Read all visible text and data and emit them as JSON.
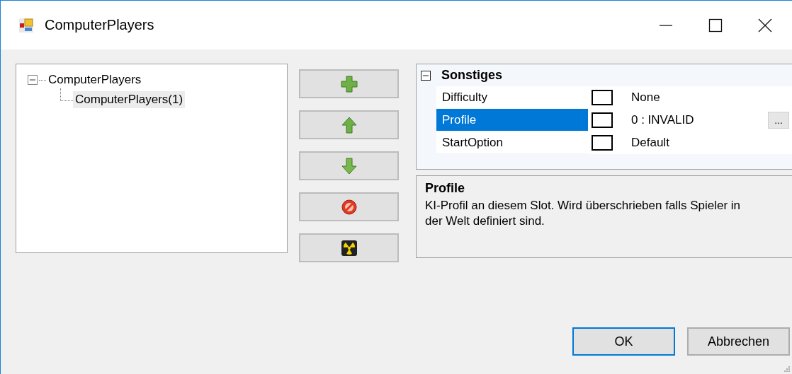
{
  "window": {
    "title": "ComputerPlayers"
  },
  "tree": [
    {
      "label": "ComputerPlayers",
      "expanded": true,
      "selected": false,
      "children": [
        {
          "label": "ComputerPlayers(1)",
          "selected": true
        }
      ]
    }
  ],
  "tool_buttons": [
    {
      "kind": "add"
    },
    {
      "kind": "up"
    },
    {
      "kind": "down"
    },
    {
      "kind": "remove"
    },
    {
      "kind": "nuke"
    }
  ],
  "property_grid": {
    "category": {
      "label": "Sonstiges",
      "expanded": true
    },
    "properties": [
      {
        "name": "Difficulty",
        "value": "None",
        "selected": false
      },
      {
        "name": "Profile",
        "value": "0 : INVALID",
        "selected": true,
        "ellipsis_button": "..."
      },
      {
        "name": "StartOption",
        "value": "Default",
        "selected": false
      }
    ]
  },
  "description": {
    "title": "Profile",
    "text": "KI-Profil an diesem Slot. Wird überschrieben falls Spieler in der Welt definiert sind."
  },
  "buttons": [
    {
      "label": "OK",
      "kind": "default"
    },
    {
      "label": "Abbrechen",
      "kind": "normal"
    }
  ]
}
